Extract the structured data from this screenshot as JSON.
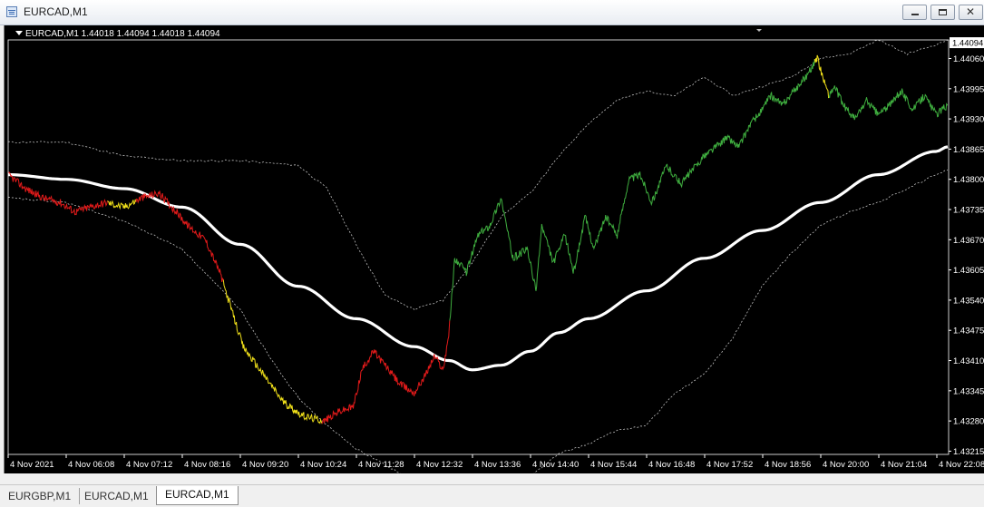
{
  "window": {
    "title": "EURCAD,M1",
    "minimize_icon": "minimize-icon",
    "restore_icon": "restore-icon",
    "close_icon": "close-icon",
    "close_glyph": "✕"
  },
  "chart": {
    "header": "EURCAD,M1  1.44018 1.44094 1.44018 1.44094",
    "colors": {
      "background": "#000000",
      "bull": "#3fae3f",
      "bear": "#e21a1a",
      "neutral": "#f0e01a",
      "ma": "#ffffff",
      "bands": "#bfbfbf"
    }
  },
  "chart_data": {
    "type": "line",
    "symbol": "EURCAD",
    "timeframe": "M1",
    "ohlc": {
      "open": 1.44018,
      "high": 1.44094,
      "low": 1.44018,
      "close": 1.44094
    },
    "current_price": 1.44094,
    "price_ticks": [
      1.4406,
      1.43995,
      1.4393,
      1.43865,
      1.438,
      1.43735,
      1.4367,
      1.43605,
      1.4354,
      1.43475,
      1.4341,
      1.43345,
      1.4328,
      1.43215
    ],
    "price_tick_labels": [
      "1.44060",
      "1.43995",
      "1.43930",
      "1.43865",
      "1.43800",
      "1.43735",
      "1.43670",
      "1.43605",
      "1.43540",
      "1.43475",
      "1.43410",
      "1.43345",
      "1.43280",
      "1.43215"
    ],
    "ylim": [
      1.4321,
      1.441
    ],
    "time_labels": [
      "4 Nov 2021",
      "4 Nov 06:08",
      "4 Nov 07:12",
      "4 Nov 08:16",
      "4 Nov 09:20",
      "4 Nov 10:24",
      "4 Nov 11:28",
      "4 Nov 12:32",
      "4 Nov 13:36",
      "4 Nov 14:40",
      "4 Nov 15:44",
      "4 Nov 16:48",
      "4 Nov 17:52",
      "4 Nov 18:56",
      "4 Nov 20:00",
      "4 Nov 21:04",
      "4 Nov 22:08"
    ],
    "series": [
      {
        "role": "price",
        "x": [
          0,
          0.3,
          0.6,
          0.9,
          1.15,
          1.4,
          1.7,
          2.0,
          2.3,
          2.6,
          2.9,
          3.1,
          3.4,
          3.65,
          3.85,
          4.05,
          4.4,
          4.75,
          5.1,
          5.45,
          5.7,
          5.95,
          6.1,
          6.3,
          6.5,
          6.75,
          7.0,
          7.2,
          7.35,
          7.5,
          7.6,
          7.7,
          7.9,
          8.1,
          8.3,
          8.5,
          8.7,
          8.95,
          9.1,
          9.2,
          9.4,
          9.6,
          9.75,
          9.95,
          10.1,
          10.3,
          10.5,
          10.7,
          10.9,
          11.1,
          11.35,
          11.6,
          11.8,
          12.0,
          12.2,
          12.4,
          12.6,
          12.8,
          12.95,
          13.15,
          13.35,
          13.55,
          13.75,
          13.95,
          14.05,
          14.15,
          14.25,
          14.4,
          14.6,
          14.8,
          15.0,
          15.2,
          15.4,
          15.6,
          15.8,
          16.0,
          16.2
        ],
        "values": [
          1.4381,
          1.4378,
          1.4376,
          1.4375,
          1.4373,
          1.4374,
          1.4375,
          1.4374,
          1.4376,
          1.4377,
          1.4373,
          1.437,
          1.4367,
          1.436,
          1.4352,
          1.4344,
          1.4338,
          1.4332,
          1.4329,
          1.4328,
          1.433,
          1.4331,
          1.4339,
          1.4343,
          1.434,
          1.4336,
          1.4334,
          1.4338,
          1.4342,
          1.4339,
          1.4347,
          1.4363,
          1.436,
          1.4368,
          1.437,
          1.4376,
          1.4363,
          1.4365,
          1.4356,
          1.437,
          1.4362,
          1.4368,
          1.436,
          1.4372,
          1.4365,
          1.4372,
          1.4368,
          1.438,
          1.4381,
          1.4375,
          1.4383,
          1.4379,
          1.4382,
          1.4385,
          1.4387,
          1.4389,
          1.4387,
          1.4392,
          1.4394,
          1.4398,
          1.4396,
          1.4399,
          1.4402,
          1.4406,
          1.4402,
          1.4398,
          1.44,
          1.4396,
          1.4393,
          1.4397,
          1.4394,
          1.4396,
          1.4399,
          1.4395,
          1.4398,
          1.4394,
          1.4396
        ]
      },
      {
        "role": "moving-average",
        "x": [
          0,
          1,
          2,
          3,
          4,
          5,
          6,
          7,
          7.6,
          8,
          8.5,
          9,
          9.5,
          10,
          11,
          12,
          13,
          14,
          15,
          16,
          16.2
        ],
        "values": [
          1.4381,
          1.438,
          1.4378,
          1.4374,
          1.4366,
          1.4357,
          1.435,
          1.4344,
          1.4341,
          1.4339,
          1.434,
          1.4343,
          1.4347,
          1.435,
          1.4356,
          1.4363,
          1.4369,
          1.4375,
          1.4381,
          1.4386,
          1.4387
        ]
      },
      {
        "role": "upper-band",
        "x": [
          0,
          1,
          2,
          3,
          4,
          5,
          5.5,
          6,
          6.5,
          7,
          7.5,
          8,
          8.5,
          9,
          9.5,
          10,
          10.5,
          11,
          11.5,
          12,
          12.5,
          13,
          13.5,
          14,
          14.5,
          15,
          15.5,
          16,
          16.2
        ],
        "values": [
          1.4388,
          1.4388,
          1.4385,
          1.4384,
          1.4384,
          1.4383,
          1.4378,
          1.4366,
          1.4355,
          1.4352,
          1.4354,
          1.4362,
          1.4372,
          1.4377,
          1.4385,
          1.4392,
          1.4397,
          1.4399,
          1.4398,
          1.4402,
          1.4398,
          1.44,
          1.4402,
          1.4406,
          1.4407,
          1.441,
          1.4407,
          1.4409,
          1.441
        ]
      },
      {
        "role": "lower-band",
        "x": [
          0,
          1,
          2,
          3,
          4,
          4.5,
          5,
          5.5,
          6,
          6.3,
          7,
          8,
          8.5,
          9,
          9.5,
          10,
          10.5,
          11,
          11.5,
          12,
          12.5,
          13,
          13.5,
          14,
          14.5,
          15,
          15.5,
          16,
          16.2
        ],
        "values": [
          1.4376,
          1.4375,
          1.4371,
          1.4365,
          1.4352,
          1.4342,
          1.4333,
          1.4327,
          1.4322,
          1.432,
          1.4315,
          1.4313,
          1.4313,
          1.4316,
          1.4321,
          1.4323,
          1.4326,
          1.4327,
          1.4334,
          1.4338,
          1.4346,
          1.4357,
          1.4364,
          1.437,
          1.4373,
          1.4375,
          1.4378,
          1.4381,
          1.4382
        ]
      }
    ],
    "grid": false
  },
  "tabs": [
    {
      "label": "EURGBP,M1",
      "active": false
    },
    {
      "label": "EURCAD,M1",
      "active": false
    },
    {
      "label": "EURCAD,M1",
      "active": true
    }
  ]
}
